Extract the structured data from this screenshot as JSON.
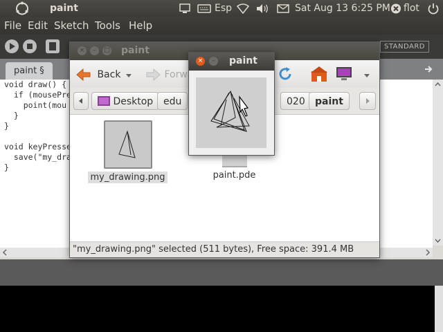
{
  "top_panel": {
    "app_name": "paint",
    "keyboard_layout": "Esp",
    "clock": "Sat Aug 13  6:25 PM",
    "user": "flot",
    "icons": [
      "ubuntu-logo-icon",
      "display-icon",
      "keyboard-icon",
      "wifi-icon",
      "volume-icon",
      "mail-icon",
      "close-circle-icon",
      "power-icon"
    ]
  },
  "menubar": {
    "items": [
      "File",
      "Edit",
      "Sketch",
      "Tools",
      "Help"
    ]
  },
  "processing_toolbar": {
    "mode_badge": "STANDARD"
  },
  "editor": {
    "tab_label": "paint §",
    "code_lines": [
      "void draw() {",
      "  if (mousePre",
      "    point(mou",
      "  }",
      "}",
      "",
      "void keyPresse",
      "  save(\"my_dra",
      "}"
    ]
  },
  "file_manager": {
    "title": "paint",
    "back_label": "Back",
    "forward_label": "Forwa",
    "path": [
      "Desktop",
      "edu",
      "020",
      "paint"
    ],
    "files": [
      {
        "name": "my_drawing.png",
        "selected": true
      },
      {
        "name": "paint.pde",
        "selected": false
      }
    ],
    "status": "\"my_drawing.png\" selected (511 bytes), Free space: 391.4 MB"
  },
  "image_viewer": {
    "title": "paint"
  },
  "colors": {
    "panel_bg": "#3c3b37",
    "accent_orange": "#e05a1c",
    "console_bg": "#000000"
  }
}
